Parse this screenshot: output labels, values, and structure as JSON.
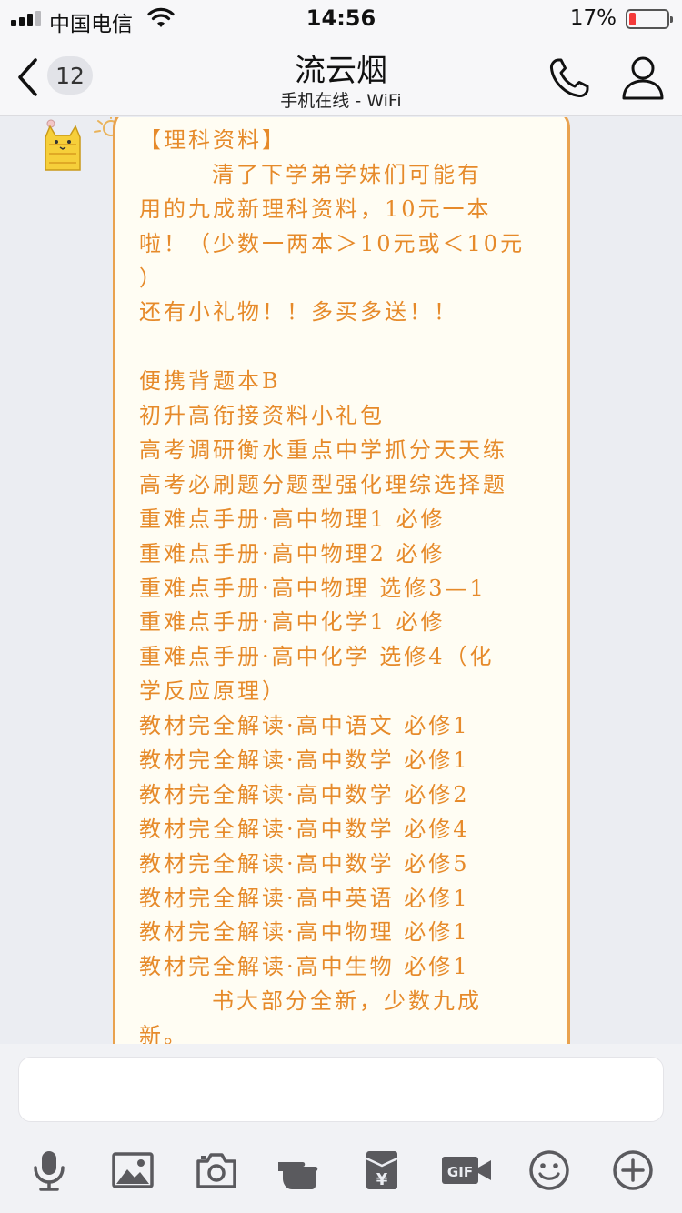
{
  "status_bar": {
    "carrier": "中国电信",
    "time": "14:56",
    "battery_percent": "17%",
    "battery_level": 0.17,
    "signal_bars": 3
  },
  "nav": {
    "unread_count": "12",
    "title": "流云烟",
    "subtitle": "手机在线 - WiFi"
  },
  "message": {
    "lines": [
      "【理科资料】",
      "清了下学弟学妹们可能有",
      "用的九成新理科资料，10元一本",
      "啦！（少数一两本＞10元或＜10元",
      "）",
      "还有小礼物！！多买多送！！",
      "",
      "便携背题本B",
      "初升高衔接资料小礼包",
      "高考调研衡水重点中学抓分天天练",
      "高考必刷题分题型强化理综选择题",
      "重难点手册·高中物理1 必修",
      "重难点手册·高中物理2 必修",
      "重难点手册·高中物理 选修3—1",
      "重难点手册·高中化学1 必修",
      "重难点手册·高中化学 选修4（化",
      "学反应原理）",
      "教材完全解读·高中语文 必修1",
      "教材完全解读·高中数学 必修1",
      "教材完全解读·高中数学 必修2",
      "教材完全解读·高中数学 必修4",
      "教材完全解读·高中数学 必修5",
      "教材完全解读·高中英语 必修1",
      "教材完全解读·高中物理 必修1",
      "教材完全解读·高中生物 必修1",
      "书大部分全新，少数九成",
      "新。"
    ]
  },
  "input": {
    "placeholder": ""
  },
  "toolbar": {
    "items": [
      "mic-icon",
      "image-icon",
      "camera-icon",
      "poke-icon",
      "red-packet-icon",
      "gif-icon",
      "emoji-icon",
      "plus-icon"
    ],
    "gif_label": "GIF",
    "redpacket_label": "¥"
  },
  "colors": {
    "bubble_text": "#e68a2a",
    "bubble_border": "#e9a24e",
    "bubble_bg": "#fffdf3",
    "chat_bg": "#ebedf2",
    "icon_gray": "#5a5a5e",
    "battery_low": "#f43a3a"
  }
}
